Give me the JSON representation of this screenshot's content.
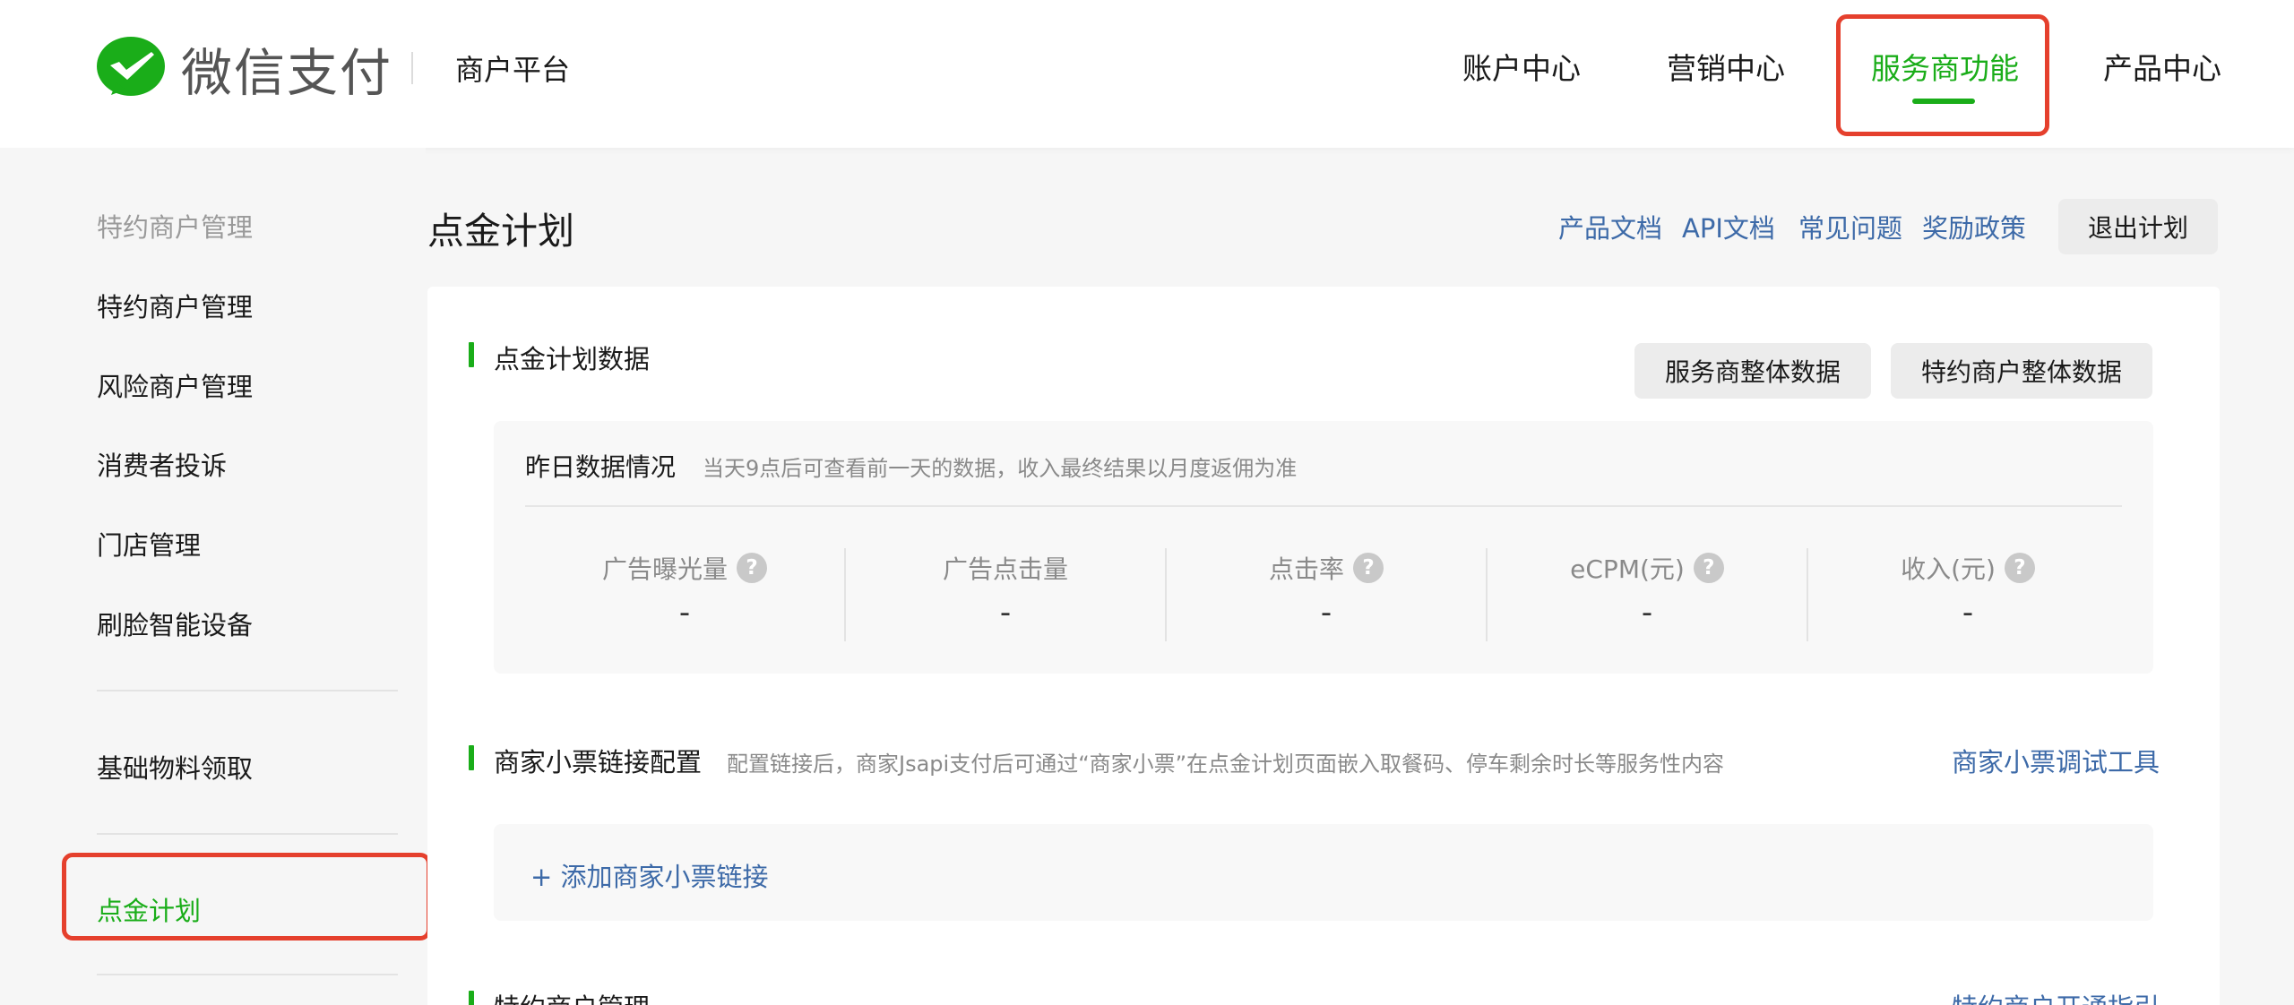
{
  "colors": {
    "brand_green": "#1aad19",
    "link_blue": "#3d6aa8",
    "highlight_red": "#e5402d"
  },
  "header": {
    "logo_text": "微信支付",
    "platform_name": "商户平台",
    "nav": [
      {
        "label": "账户中心",
        "active": false
      },
      {
        "label": "营销中心",
        "active": false
      },
      {
        "label": "服务商功能",
        "active": true
      },
      {
        "label": "产品中心",
        "active": false
      }
    ]
  },
  "sidebar": {
    "group_title": "特约商户管理",
    "items": [
      {
        "label": "特约商户管理"
      },
      {
        "label": "风险商户管理"
      },
      {
        "label": "消费者投诉"
      },
      {
        "label": "门店管理"
      },
      {
        "label": "刷脸智能设备"
      }
    ],
    "materials": {
      "label": "基础物料领取"
    },
    "active_item": {
      "label": "点金计划"
    }
  },
  "main": {
    "page_title": "点金计划",
    "links": [
      "产品文档",
      "API文档",
      "常见问题",
      "奖励政策"
    ],
    "exit_button": "退出计划",
    "data_section": {
      "title": "点金计划数据",
      "buttons": [
        "服务商整体数据",
        "特约商户整体数据"
      ],
      "stats_heading": "昨日数据情况",
      "stats_hint": "当天9点后可查看前一天的数据，收入最终结果以月度返佣为准",
      "metrics": [
        {
          "label": "广告曝光量",
          "value": "-",
          "help": true
        },
        {
          "label": "广告点击量",
          "value": "-",
          "help": false
        },
        {
          "label": "点击率",
          "value": "-",
          "help": true
        },
        {
          "label": "eCPM(元)",
          "value": "-",
          "help": true
        },
        {
          "label": "收入(元)",
          "value": "-",
          "help": true
        }
      ]
    },
    "receipt_section": {
      "title": "商家小票链接配置",
      "hint": "配置链接后，商家Jsapi支付后可通过“商家小票”在点金计划页面嵌入取餐码、停车剩余时长等服务性内容",
      "tool_link": "商家小票调试工具",
      "add_link": "+ 添加商家小票链接"
    },
    "merchant_section": {
      "title": "特约商户管理",
      "guide_link": "特约商户开通指引"
    }
  }
}
